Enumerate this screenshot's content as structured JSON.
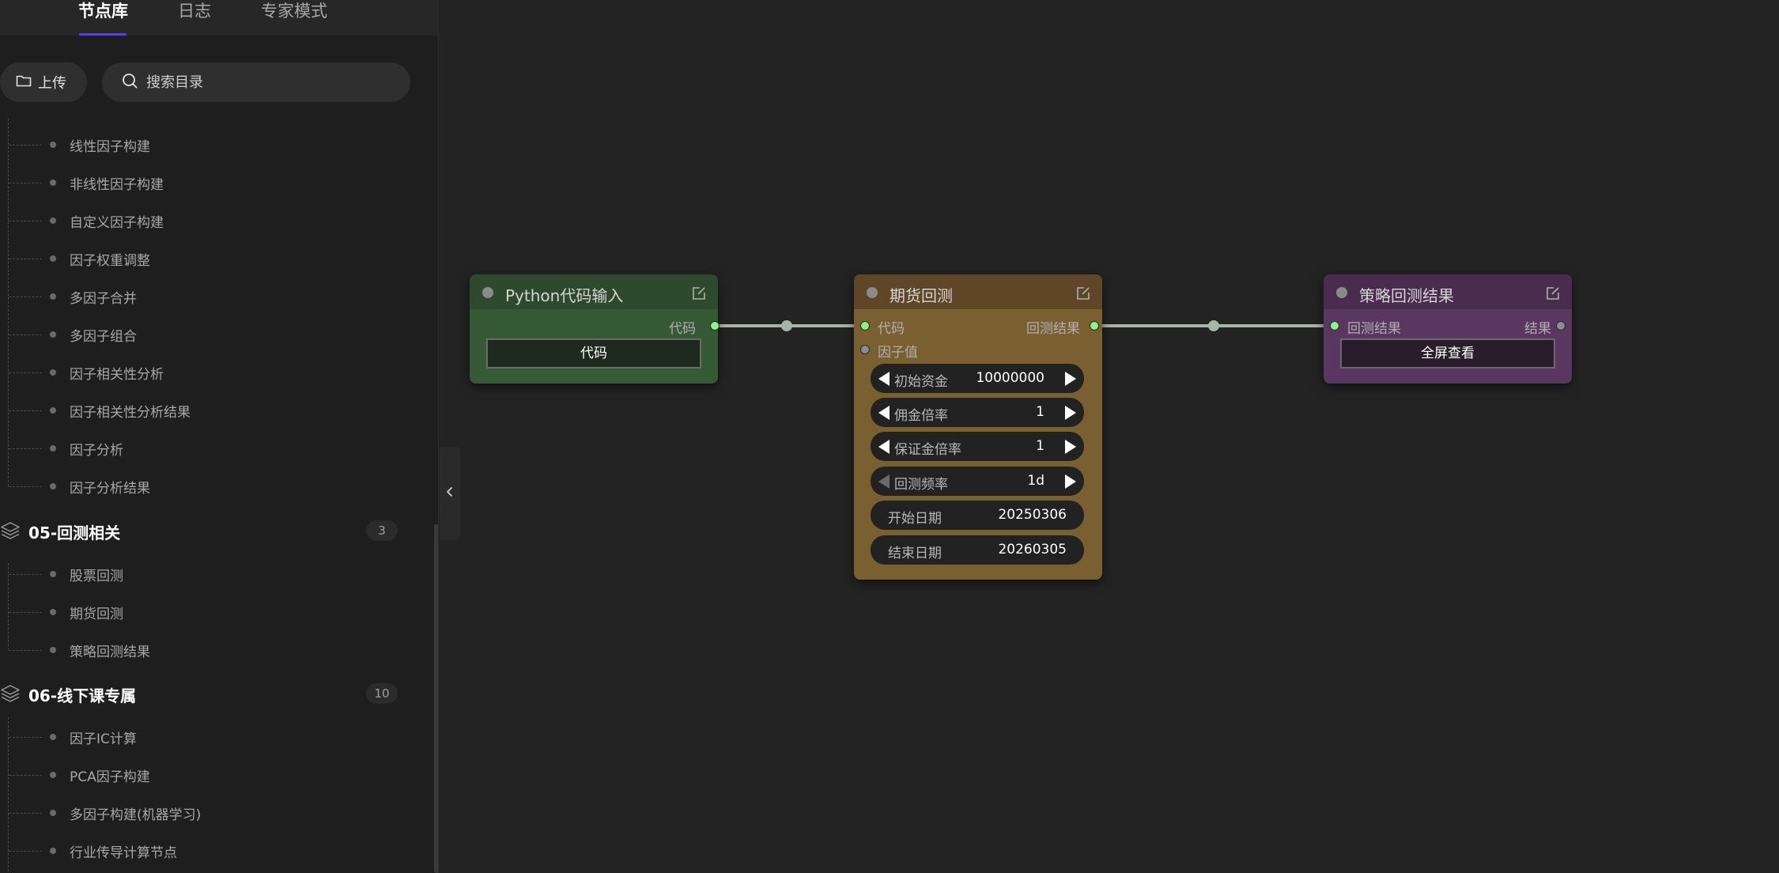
{
  "tabs": [
    {
      "label": "节点库",
      "active": true
    },
    {
      "label": "日志",
      "active": false
    },
    {
      "label": "专家模式",
      "active": false
    }
  ],
  "toolbar": {
    "upload_label": "上传"
  },
  "search": {
    "placeholder": "搜索目录",
    "value": ""
  },
  "tree": {
    "items_top": [
      "线性因子构建",
      "非线性因子构建",
      "自定义因子构建",
      "因子权重调整",
      "多因子合并",
      "多因子组合",
      "因子相关性分析",
      "因子相关性分析结果",
      "因子分析",
      "因子分析结果"
    ],
    "groups": [
      {
        "label": "05-回测相关",
        "count": "3",
        "items": [
          "股票回测",
          "期货回测",
          "策略回测结果"
        ]
      },
      {
        "label": "06-线下课专属",
        "count": "10",
        "items": [
          "因子IC计算",
          "PCA因子构建",
          "多因子构建(机器学习)",
          "行业传导计算节点"
        ]
      }
    ]
  },
  "nodes": {
    "python": {
      "title": "Python代码输入",
      "output_label": "代码",
      "button_label": "代码",
      "header_color": "#2e4a2e",
      "body_color": "#355a35"
    },
    "futures": {
      "title": "期货回测",
      "inputs": [
        "代码",
        "因子值"
      ],
      "output_label": "回测结果",
      "header_color": "#5e4626",
      "body_color": "#7a5f30",
      "widgets": [
        {
          "label": "初始资金",
          "value": "10000000"
        },
        {
          "label": "佣金倍率",
          "value": "1"
        },
        {
          "label": "保证金倍率",
          "value": "1"
        },
        {
          "label": "回测频率",
          "value": "1d"
        }
      ],
      "text_widgets": [
        {
          "label": "开始日期",
          "value": "20250306"
        },
        {
          "label": "结束日期",
          "value": "20260305"
        }
      ]
    },
    "result": {
      "title": "策略回测结果",
      "input_label": "回测结果",
      "output_label": "结果",
      "button_label": "全屏查看",
      "header_color": "#4a2d4e",
      "body_color": "#5a3760"
    }
  },
  "colors": {
    "accent": "#5b3ee6",
    "port_connected": "#8cf28c",
    "port_empty": "#8c8c98",
    "wire": "#a7b4a7"
  }
}
